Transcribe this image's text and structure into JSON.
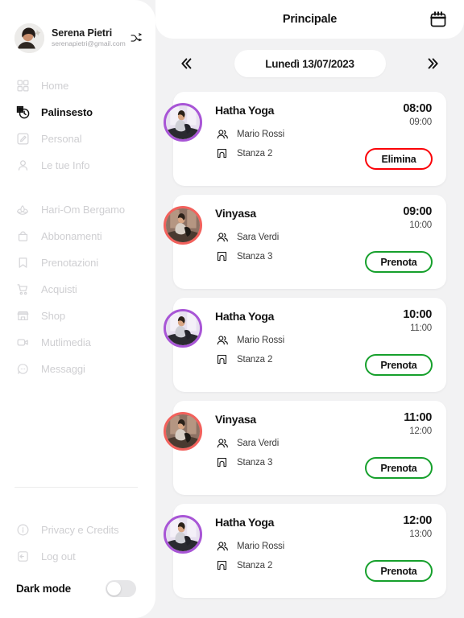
{
  "sidebar": {
    "profile": {
      "name": "Serena Pietri",
      "email": "serenapietri@gmail.com",
      "avatar_icon": "user-photo",
      "switch_icon": "shuffle-icon"
    },
    "primary_items": [
      {
        "label": "Home",
        "icon": "grid-icon",
        "active": false
      },
      {
        "label": "Palinsesto",
        "icon": "schedule-clock-icon",
        "active": true
      },
      {
        "label": "Personal",
        "icon": "edit-square-icon",
        "active": false
      },
      {
        "label": "Le tue Info",
        "icon": "person-icon",
        "active": false
      }
    ],
    "secondary_items": [
      {
        "label": "Hari-Om Bergamo",
        "icon": "lotus-icon"
      },
      {
        "label": "Abbonamenti",
        "icon": "wallet-icon"
      },
      {
        "label": "Prenotazioni",
        "icon": "bookmark-icon"
      },
      {
        "label": "Acquisti",
        "icon": "cart-icon"
      },
      {
        "label": "Shop",
        "icon": "store-icon"
      },
      {
        "label": "Mutlimedia",
        "icon": "video-icon"
      },
      {
        "label": "Messaggi",
        "icon": "chat-icon"
      }
    ],
    "footer_items": [
      {
        "label": "Privacy e Credits",
        "icon": "info-circle-icon"
      },
      {
        "label": "Log out",
        "icon": "logout-icon"
      }
    ],
    "dark_mode": {
      "label": "Dark mode",
      "enabled": false
    }
  },
  "header": {
    "title": "Principale",
    "calendar_icon": "calendar-icon"
  },
  "datebar": {
    "prev_icon": "double-chevron-left-icon",
    "next_icon": "double-chevron-right-icon",
    "current_date": "Lunedì 13/07/2023"
  },
  "colors": {
    "background": "#f2f2f3",
    "surface": "#ffffff",
    "accent_green": "#16a02c",
    "accent_red": "#fb0007",
    "ring_purple": "#a855d6",
    "ring_coral": "#f2615c",
    "muted_text": "#cfcfd2"
  },
  "classes": [
    {
      "title": "Hatha Yoga",
      "start_time": "08:00",
      "end_time": "09:00",
      "instructor": "Mario Rossi",
      "room": "Stanza 2",
      "action_label": "Elimina",
      "action_type": "danger",
      "ring": "purple",
      "instructor_icon": "people-icon",
      "room_icon": "room-icon"
    },
    {
      "title": "Vinyasa",
      "start_time": "09:00",
      "end_time": "10:00",
      "instructor": "Sara Verdi",
      "room": "Stanza 3",
      "action_label": "Prenota",
      "action_type": "primary",
      "ring": "coral",
      "instructor_icon": "people-icon",
      "room_icon": "room-icon"
    },
    {
      "title": "Hatha Yoga",
      "start_time": "10:00",
      "end_time": "11:00",
      "instructor": "Mario Rossi",
      "room": "Stanza 2",
      "action_label": "Prenota",
      "action_type": "primary",
      "ring": "purple",
      "instructor_icon": "people-icon",
      "room_icon": "room-icon"
    },
    {
      "title": "Vinyasa",
      "start_time": "11:00",
      "end_time": "12:00",
      "instructor": "Sara Verdi",
      "room": "Stanza 3",
      "action_label": "Prenota",
      "action_type": "primary",
      "ring": "coral",
      "instructor_icon": "people-icon",
      "room_icon": "room-icon"
    },
    {
      "title": "Hatha Yoga",
      "start_time": "12:00",
      "end_time": "13:00",
      "instructor": "Mario Rossi",
      "room": "Stanza 2",
      "action_label": "Prenota",
      "action_type": "primary",
      "ring": "purple",
      "instructor_icon": "people-icon",
      "room_icon": "room-icon"
    }
  ]
}
